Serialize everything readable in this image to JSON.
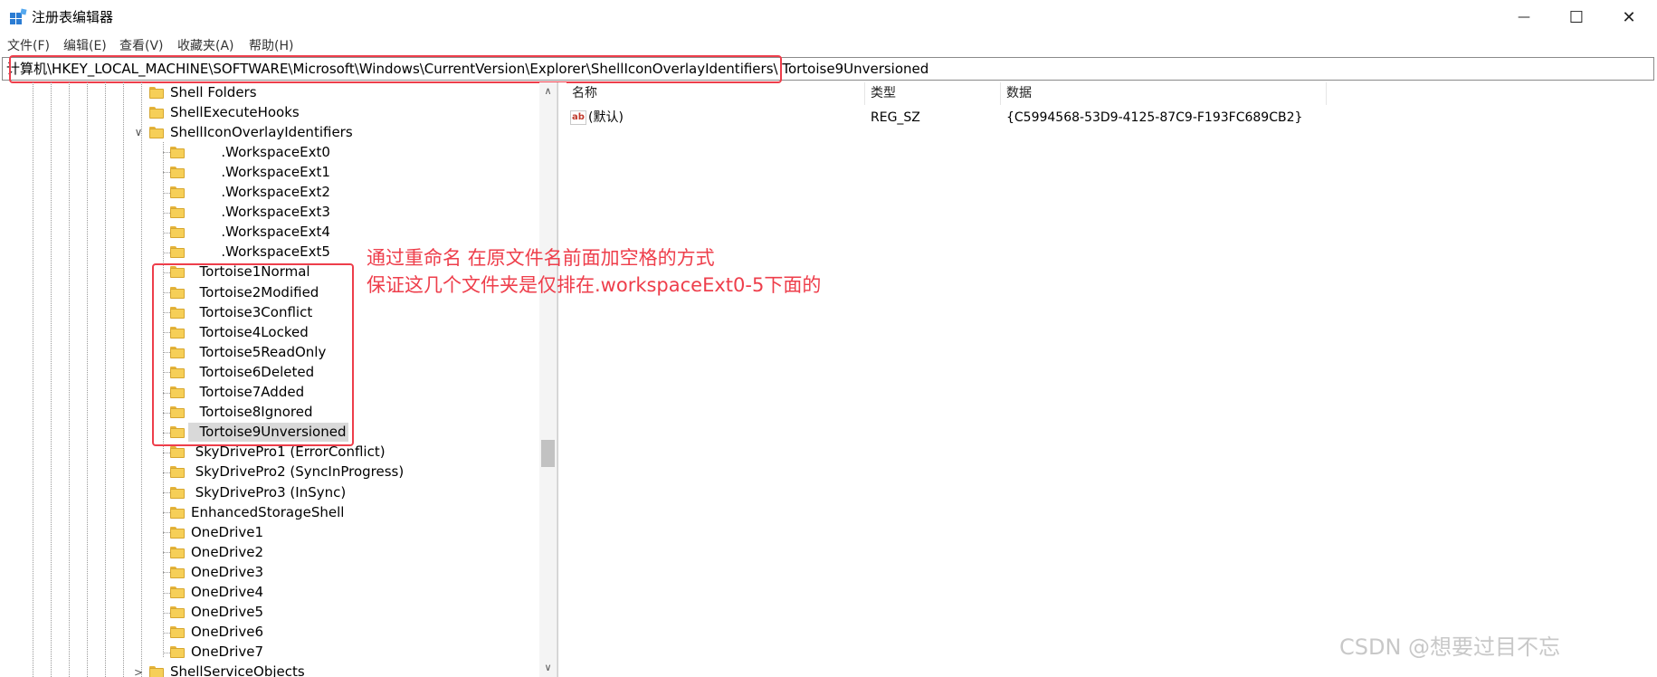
{
  "window": {
    "title": "注册表编辑器",
    "minimize_glyph": "—",
    "maximize_glyph": "☐",
    "close_glyph": "✕"
  },
  "menu": [
    {
      "label": "文件(F)"
    },
    {
      "label": "编辑(E)"
    },
    {
      "label": "查看(V)"
    },
    {
      "label": "收藏夹(A)"
    },
    {
      "label": "帮助(H)"
    }
  ],
  "address": {
    "path": "计算机\\HKEY_LOCAL_MACHINE\\SOFTWARE\\Microsoft\\Windows\\CurrentVersion\\Explorer\\ShellIconOverlayIdentifiers\\  Tortoise9Unversioned"
  },
  "tree": {
    "items": [
      {
        "label": "Shell Folders"
      },
      {
        "label": "ShellExecuteHooks"
      },
      {
        "label": "ShellIconOverlayIdentifiers",
        "expander": "∨"
      },
      {
        "label": "       .WorkspaceExt0"
      },
      {
        "label": "       .WorkspaceExt1"
      },
      {
        "label": "       .WorkspaceExt2"
      },
      {
        "label": "       .WorkspaceExt3"
      },
      {
        "label": "       .WorkspaceExt4"
      },
      {
        "label": "       .WorkspaceExt5"
      },
      {
        "label": "  Tortoise1Normal"
      },
      {
        "label": "  Tortoise2Modified"
      },
      {
        "label": "  Tortoise3Conflict"
      },
      {
        "label": "  Tortoise4Locked"
      },
      {
        "label": "  Tortoise5ReadOnly"
      },
      {
        "label": "  Tortoise6Deleted"
      },
      {
        "label": "  Tortoise7Added"
      },
      {
        "label": "  Tortoise8Ignored"
      },
      {
        "label": "  Tortoise9Unversioned"
      },
      {
        "label": " SkyDrivePro1 (ErrorConflict)"
      },
      {
        "label": " SkyDrivePro2 (SyncInProgress)"
      },
      {
        "label": " SkyDrivePro3 (InSync)"
      },
      {
        "label": "EnhancedStorageShell"
      },
      {
        "label": "OneDrive1"
      },
      {
        "label": "OneDrive2"
      },
      {
        "label": "OneDrive3"
      },
      {
        "label": "OneDrive4"
      },
      {
        "label": "OneDrive5"
      },
      {
        "label": "OneDrive6"
      },
      {
        "label": "OneDrive7"
      },
      {
        "label": "ShellServiceObjects",
        "expander": ">"
      }
    ],
    "scroll_up": "∧",
    "scroll_down": "∨"
  },
  "list": {
    "columns": [
      "名称",
      "类型",
      "数据"
    ],
    "rows": [
      {
        "icon": "ab",
        "name": "(默认)",
        "type": "REG_SZ",
        "data": "{C5994568-53D9-4125-87C9-F193FC689CB2}"
      }
    ]
  },
  "annotation": {
    "line1": "通过重命名 在原文件名前面加空格的方式",
    "line2": "保证这几个文件夹是仅排在.workspaceExt0-5下面的"
  },
  "watermark": "CSDN @想要过目不忘",
  "colors": {
    "annotation_red": "#ee3e4b",
    "selection_gray": "#d9d9d9",
    "folder_yellow": "#f6cf58"
  }
}
